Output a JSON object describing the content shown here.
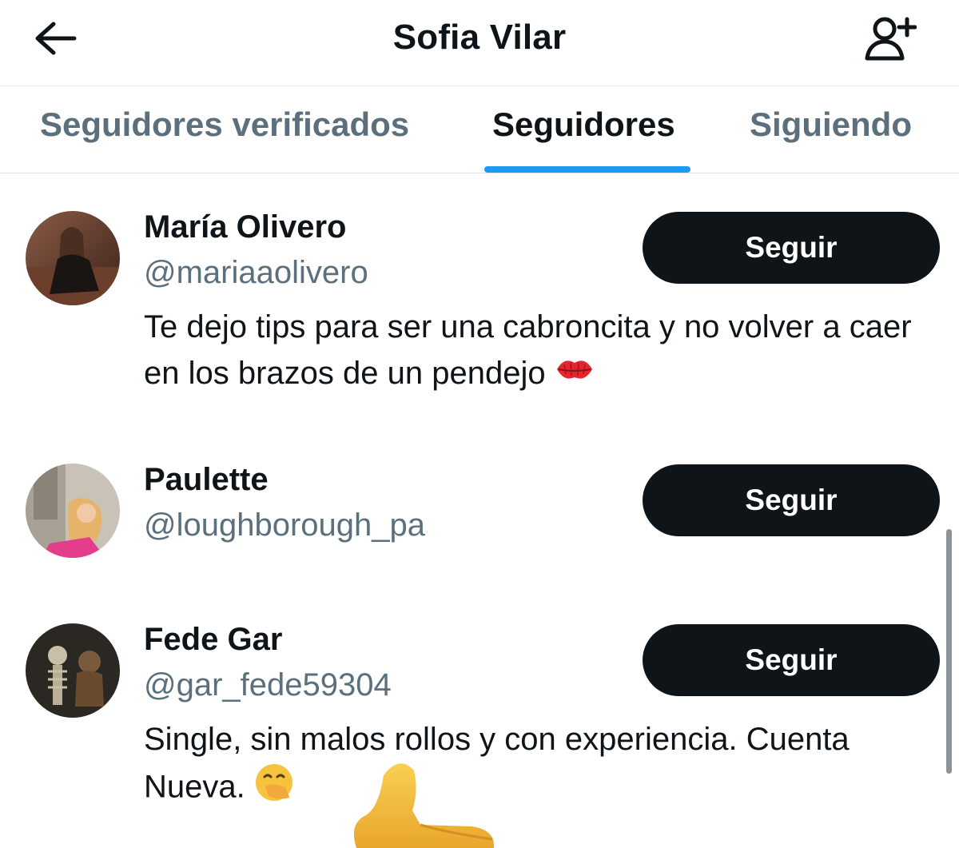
{
  "header": {
    "title": "Sofia Vilar",
    "back_icon": "arrow-left-icon",
    "add_user_icon": "person-add-icon"
  },
  "tabs": [
    {
      "label": "Seguidores verificados",
      "active": false
    },
    {
      "label": "Seguidores",
      "active": true
    },
    {
      "label": "Siguiendo",
      "active": false
    }
  ],
  "colors": {
    "accent": "#1d9bf0",
    "button_bg": "#0f1419",
    "secondary_text": "#5b6f7d"
  },
  "users": [
    {
      "name": "María Olivero",
      "handle": "@mariaaolivero",
      "bio": "Te dejo tips para ser una cabroncita y no volver a caer en los brazos de un pendejo",
      "bio_emoji": "kiss-mark-emoji",
      "button_label": "Seguir"
    },
    {
      "name": "Paulette",
      "handle": "@loughborough_pa",
      "bio": "",
      "button_label": "Seguir"
    },
    {
      "name": "Fede Gar",
      "handle": "@gar_fede59304",
      "bio": "Single, sin malos rollos y con experiencia. Cuenta Nueva.",
      "bio_emoji": "face-with-hand-over-mouth-emoji",
      "button_label": "Seguir"
    }
  ],
  "overlay": {
    "icon": "thumbs-up-emoji"
  }
}
